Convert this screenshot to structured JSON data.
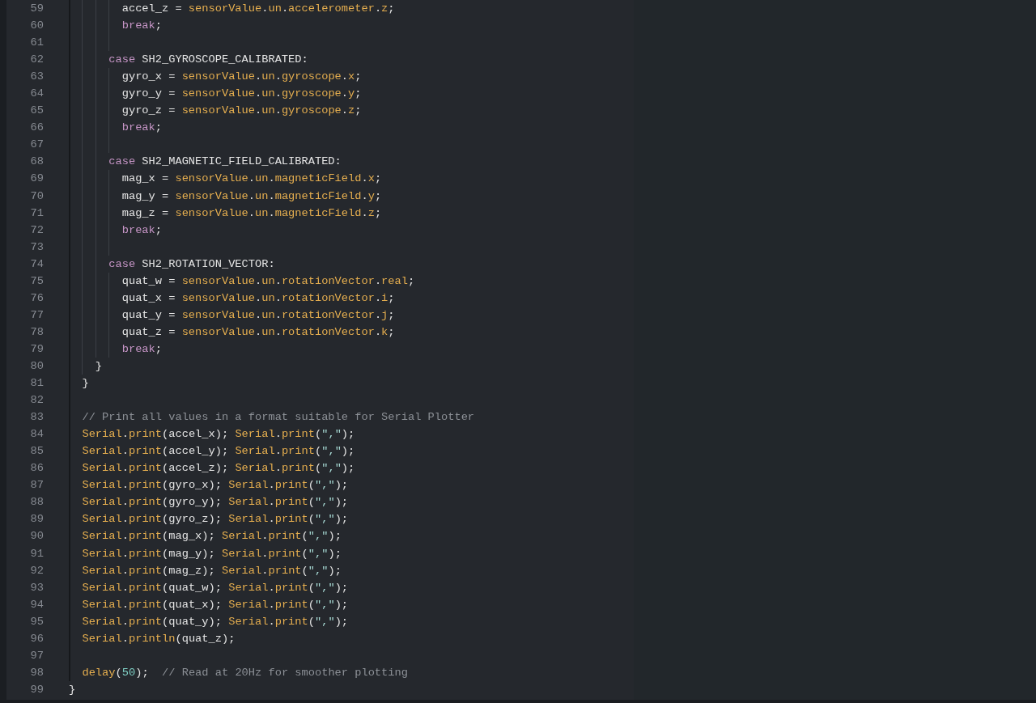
{
  "editor": {
    "lines": [
      {
        "number": "59",
        "tokens": [
          {
            "text": "        accel_z = ",
            "kind": "plain"
          },
          {
            "text": "sensorValue",
            "kind": "member"
          },
          {
            "text": ".",
            "kind": "plain"
          },
          {
            "text": "un",
            "kind": "member"
          },
          {
            "text": ".",
            "kind": "plain"
          },
          {
            "text": "accelerometer",
            "kind": "member"
          },
          {
            "text": ".",
            "kind": "plain"
          },
          {
            "text": "z",
            "kind": "member"
          },
          {
            "text": ";",
            "kind": "plain"
          }
        ]
      },
      {
        "number": "60",
        "tokens": [
          {
            "text": "        break",
            "kind": "keyword"
          },
          {
            "text": ";",
            "kind": "plain"
          }
        ]
      },
      {
        "number": "61"
      },
      {
        "number": "62",
        "tokens": [
          {
            "text": "      case",
            "kind": "keyword"
          },
          {
            "text": " SH2_GYROSCOPE_CALIBRATED:",
            "kind": "plain"
          }
        ]
      },
      {
        "number": "63",
        "tokens": [
          {
            "text": "        gyro_x = ",
            "kind": "plain"
          },
          {
            "text": "sensorValue",
            "kind": "member"
          },
          {
            "text": ".",
            "kind": "plain"
          },
          {
            "text": "un",
            "kind": "member"
          },
          {
            "text": ".",
            "kind": "plain"
          },
          {
            "text": "gyroscope",
            "kind": "member"
          },
          {
            "text": ".",
            "kind": "plain"
          },
          {
            "text": "x",
            "kind": "member"
          },
          {
            "text": ";",
            "kind": "plain"
          }
        ]
      },
      {
        "number": "64",
        "tokens": [
          {
            "text": "        gyro_y = ",
            "kind": "plain"
          },
          {
            "text": "sensorValue",
            "kind": "member"
          },
          {
            "text": ".",
            "kind": "plain"
          },
          {
            "text": "un",
            "kind": "member"
          },
          {
            "text": ".",
            "kind": "plain"
          },
          {
            "text": "gyroscope",
            "kind": "member"
          },
          {
            "text": ".",
            "kind": "plain"
          },
          {
            "text": "y",
            "kind": "member"
          },
          {
            "text": ";",
            "kind": "plain"
          }
        ]
      },
      {
        "number": "65",
        "tokens": [
          {
            "text": "        gyro_z = ",
            "kind": "plain"
          },
          {
            "text": "sensorValue",
            "kind": "member"
          },
          {
            "text": ".",
            "kind": "plain"
          },
          {
            "text": "un",
            "kind": "member"
          },
          {
            "text": ".",
            "kind": "plain"
          },
          {
            "text": "gyroscope",
            "kind": "member"
          },
          {
            "text": ".",
            "kind": "plain"
          },
          {
            "text": "z",
            "kind": "member"
          },
          {
            "text": ";",
            "kind": "plain"
          }
        ]
      },
      {
        "number": "66",
        "tokens": [
          {
            "text": "        break",
            "kind": "keyword"
          },
          {
            "text": ";",
            "kind": "plain"
          }
        ]
      },
      {
        "number": "67"
      },
      {
        "number": "68",
        "tokens": [
          {
            "text": "      case",
            "kind": "keyword"
          },
          {
            "text": " SH2_MAGNETIC_FIELD_CALIBRATED:",
            "kind": "plain"
          }
        ]
      },
      {
        "number": "69",
        "tokens": [
          {
            "text": "        mag_x = ",
            "kind": "plain"
          },
          {
            "text": "sensorValue",
            "kind": "member"
          },
          {
            "text": ".",
            "kind": "plain"
          },
          {
            "text": "un",
            "kind": "member"
          },
          {
            "text": ".",
            "kind": "plain"
          },
          {
            "text": "magneticField",
            "kind": "member"
          },
          {
            "text": ".",
            "kind": "plain"
          },
          {
            "text": "x",
            "kind": "member"
          },
          {
            "text": ";",
            "kind": "plain"
          }
        ]
      },
      {
        "number": "70",
        "tokens": [
          {
            "text": "        mag_y = ",
            "kind": "plain"
          },
          {
            "text": "sensorValue",
            "kind": "member"
          },
          {
            "text": ".",
            "kind": "plain"
          },
          {
            "text": "un",
            "kind": "member"
          },
          {
            "text": ".",
            "kind": "plain"
          },
          {
            "text": "magneticField",
            "kind": "member"
          },
          {
            "text": ".",
            "kind": "plain"
          },
          {
            "text": "y",
            "kind": "member"
          },
          {
            "text": ";",
            "kind": "plain"
          }
        ]
      },
      {
        "number": "71",
        "tokens": [
          {
            "text": "        mag_z = ",
            "kind": "plain"
          },
          {
            "text": "sensorValue",
            "kind": "member"
          },
          {
            "text": ".",
            "kind": "plain"
          },
          {
            "text": "un",
            "kind": "member"
          },
          {
            "text": ".",
            "kind": "plain"
          },
          {
            "text": "magneticField",
            "kind": "member"
          },
          {
            "text": ".",
            "kind": "plain"
          },
          {
            "text": "z",
            "kind": "member"
          },
          {
            "text": ";",
            "kind": "plain"
          }
        ]
      },
      {
        "number": "72",
        "tokens": [
          {
            "text": "        break",
            "kind": "keyword"
          },
          {
            "text": ";",
            "kind": "plain"
          }
        ]
      },
      {
        "number": "73"
      },
      {
        "number": "74",
        "tokens": [
          {
            "text": "      case",
            "kind": "keyword"
          },
          {
            "text": " SH2_ROTATION_VECTOR:",
            "kind": "plain"
          }
        ]
      },
      {
        "number": "75",
        "tokens": [
          {
            "text": "        quat_w = ",
            "kind": "plain"
          },
          {
            "text": "sensorValue",
            "kind": "member"
          },
          {
            "text": ".",
            "kind": "plain"
          },
          {
            "text": "un",
            "kind": "member"
          },
          {
            "text": ".",
            "kind": "plain"
          },
          {
            "text": "rotationVector",
            "kind": "member"
          },
          {
            "text": ".",
            "kind": "plain"
          },
          {
            "text": "real",
            "kind": "member"
          },
          {
            "text": ";",
            "kind": "plain"
          }
        ]
      },
      {
        "number": "76",
        "tokens": [
          {
            "text": "        quat_x = ",
            "kind": "plain"
          },
          {
            "text": "sensorValue",
            "kind": "member"
          },
          {
            "text": ".",
            "kind": "plain"
          },
          {
            "text": "un",
            "kind": "member"
          },
          {
            "text": ".",
            "kind": "plain"
          },
          {
            "text": "rotationVector",
            "kind": "member"
          },
          {
            "text": ".",
            "kind": "plain"
          },
          {
            "text": "i",
            "kind": "member"
          },
          {
            "text": ";",
            "kind": "plain"
          }
        ]
      },
      {
        "number": "77",
        "tokens": [
          {
            "text": "        quat_y = ",
            "kind": "plain"
          },
          {
            "text": "sensorValue",
            "kind": "member"
          },
          {
            "text": ".",
            "kind": "plain"
          },
          {
            "text": "un",
            "kind": "member"
          },
          {
            "text": ".",
            "kind": "plain"
          },
          {
            "text": "rotationVector",
            "kind": "member"
          },
          {
            "text": ".",
            "kind": "plain"
          },
          {
            "text": "j",
            "kind": "member"
          },
          {
            "text": ";",
            "kind": "plain"
          }
        ]
      },
      {
        "number": "78",
        "tokens": [
          {
            "text": "        quat_z = ",
            "kind": "plain"
          },
          {
            "text": "sensorValue",
            "kind": "member"
          },
          {
            "text": ".",
            "kind": "plain"
          },
          {
            "text": "un",
            "kind": "member"
          },
          {
            "text": ".",
            "kind": "plain"
          },
          {
            "text": "rotationVector",
            "kind": "member"
          },
          {
            "text": ".",
            "kind": "plain"
          },
          {
            "text": "k",
            "kind": "member"
          },
          {
            "text": ";",
            "kind": "plain"
          }
        ]
      },
      {
        "number": "79",
        "tokens": [
          {
            "text": "        break",
            "kind": "keyword"
          },
          {
            "text": ";",
            "kind": "plain"
          }
        ]
      },
      {
        "number": "80",
        "tokens": [
          {
            "text": "    }",
            "kind": "plain"
          }
        ]
      },
      {
        "number": "81",
        "tokens": [
          {
            "text": "  }",
            "kind": "plain"
          }
        ]
      },
      {
        "number": "82"
      },
      {
        "number": "83",
        "tokens": [
          {
            "text": "  // Print all values in a format suitable for Serial Plotter",
            "kind": "comment"
          }
        ]
      },
      {
        "number": "84",
        "tokens": [
          {
            "text": "  Serial",
            "kind": "member"
          },
          {
            "text": ".",
            "kind": "plain"
          },
          {
            "text": "print",
            "kind": "member"
          },
          {
            "text": "(accel_x); ",
            "kind": "plain"
          },
          {
            "text": "Serial",
            "kind": "member"
          },
          {
            "text": ".",
            "kind": "plain"
          },
          {
            "text": "print",
            "kind": "member"
          },
          {
            "text": "(",
            "kind": "plain"
          },
          {
            "text": "\",\"",
            "kind": "string"
          },
          {
            "text": ");",
            "kind": "plain"
          }
        ]
      },
      {
        "number": "85",
        "tokens": [
          {
            "text": "  Serial",
            "kind": "member"
          },
          {
            "text": ".",
            "kind": "plain"
          },
          {
            "text": "print",
            "kind": "member"
          },
          {
            "text": "(accel_y); ",
            "kind": "plain"
          },
          {
            "text": "Serial",
            "kind": "member"
          },
          {
            "text": ".",
            "kind": "plain"
          },
          {
            "text": "print",
            "kind": "member"
          },
          {
            "text": "(",
            "kind": "plain"
          },
          {
            "text": "\",\"",
            "kind": "string"
          },
          {
            "text": ");",
            "kind": "plain"
          }
        ]
      },
      {
        "number": "86",
        "tokens": [
          {
            "text": "  Serial",
            "kind": "member"
          },
          {
            "text": ".",
            "kind": "plain"
          },
          {
            "text": "print",
            "kind": "member"
          },
          {
            "text": "(accel_z); ",
            "kind": "plain"
          },
          {
            "text": "Serial",
            "kind": "member"
          },
          {
            "text": ".",
            "kind": "plain"
          },
          {
            "text": "print",
            "kind": "member"
          },
          {
            "text": "(",
            "kind": "plain"
          },
          {
            "text": "\",\"",
            "kind": "string"
          },
          {
            "text": ");",
            "kind": "plain"
          }
        ]
      },
      {
        "number": "87",
        "tokens": [
          {
            "text": "  Serial",
            "kind": "member"
          },
          {
            "text": ".",
            "kind": "plain"
          },
          {
            "text": "print",
            "kind": "member"
          },
          {
            "text": "(gyro_x); ",
            "kind": "plain"
          },
          {
            "text": "Serial",
            "kind": "member"
          },
          {
            "text": ".",
            "kind": "plain"
          },
          {
            "text": "print",
            "kind": "member"
          },
          {
            "text": "(",
            "kind": "plain"
          },
          {
            "text": "\",\"",
            "kind": "string"
          },
          {
            "text": ");",
            "kind": "plain"
          }
        ]
      },
      {
        "number": "88",
        "tokens": [
          {
            "text": "  Serial",
            "kind": "member"
          },
          {
            "text": ".",
            "kind": "plain"
          },
          {
            "text": "print",
            "kind": "member"
          },
          {
            "text": "(gyro_y); ",
            "kind": "plain"
          },
          {
            "text": "Serial",
            "kind": "member"
          },
          {
            "text": ".",
            "kind": "plain"
          },
          {
            "text": "print",
            "kind": "member"
          },
          {
            "text": "(",
            "kind": "plain"
          },
          {
            "text": "\",\"",
            "kind": "string"
          },
          {
            "text": ");",
            "kind": "plain"
          }
        ]
      },
      {
        "number": "89",
        "tokens": [
          {
            "text": "  Serial",
            "kind": "member"
          },
          {
            "text": ".",
            "kind": "plain"
          },
          {
            "text": "print",
            "kind": "member"
          },
          {
            "text": "(gyro_z); ",
            "kind": "plain"
          },
          {
            "text": "Serial",
            "kind": "member"
          },
          {
            "text": ".",
            "kind": "plain"
          },
          {
            "text": "print",
            "kind": "member"
          },
          {
            "text": "(",
            "kind": "plain"
          },
          {
            "text": "\",\"",
            "kind": "string"
          },
          {
            "text": ");",
            "kind": "plain"
          }
        ]
      },
      {
        "number": "90",
        "tokens": [
          {
            "text": "  Serial",
            "kind": "member"
          },
          {
            "text": ".",
            "kind": "plain"
          },
          {
            "text": "print",
            "kind": "member"
          },
          {
            "text": "(mag_x); ",
            "kind": "plain"
          },
          {
            "text": "Serial",
            "kind": "member"
          },
          {
            "text": ".",
            "kind": "plain"
          },
          {
            "text": "print",
            "kind": "member"
          },
          {
            "text": "(",
            "kind": "plain"
          },
          {
            "text": "\",\"",
            "kind": "string"
          },
          {
            "text": ");",
            "kind": "plain"
          }
        ]
      },
      {
        "number": "91",
        "tokens": [
          {
            "text": "  Serial",
            "kind": "member"
          },
          {
            "text": ".",
            "kind": "plain"
          },
          {
            "text": "print",
            "kind": "member"
          },
          {
            "text": "(mag_y); ",
            "kind": "plain"
          },
          {
            "text": "Serial",
            "kind": "member"
          },
          {
            "text": ".",
            "kind": "plain"
          },
          {
            "text": "print",
            "kind": "member"
          },
          {
            "text": "(",
            "kind": "plain"
          },
          {
            "text": "\",\"",
            "kind": "string"
          },
          {
            "text": ");",
            "kind": "plain"
          }
        ]
      },
      {
        "number": "92",
        "tokens": [
          {
            "text": "  Serial",
            "kind": "member"
          },
          {
            "text": ".",
            "kind": "plain"
          },
          {
            "text": "print",
            "kind": "member"
          },
          {
            "text": "(mag_z); ",
            "kind": "plain"
          },
          {
            "text": "Serial",
            "kind": "member"
          },
          {
            "text": ".",
            "kind": "plain"
          },
          {
            "text": "print",
            "kind": "member"
          },
          {
            "text": "(",
            "kind": "plain"
          },
          {
            "text": "\",\"",
            "kind": "string"
          },
          {
            "text": ");",
            "kind": "plain"
          }
        ]
      },
      {
        "number": "93",
        "tokens": [
          {
            "text": "  Serial",
            "kind": "member"
          },
          {
            "text": ".",
            "kind": "plain"
          },
          {
            "text": "print",
            "kind": "member"
          },
          {
            "text": "(quat_w); ",
            "kind": "plain"
          },
          {
            "text": "Serial",
            "kind": "member"
          },
          {
            "text": ".",
            "kind": "plain"
          },
          {
            "text": "print",
            "kind": "member"
          },
          {
            "text": "(",
            "kind": "plain"
          },
          {
            "text": "\",\"",
            "kind": "string"
          },
          {
            "text": ");",
            "kind": "plain"
          }
        ]
      },
      {
        "number": "94",
        "tokens": [
          {
            "text": "  Serial",
            "kind": "member"
          },
          {
            "text": ".",
            "kind": "plain"
          },
          {
            "text": "print",
            "kind": "member"
          },
          {
            "text": "(quat_x); ",
            "kind": "plain"
          },
          {
            "text": "Serial",
            "kind": "member"
          },
          {
            "text": ".",
            "kind": "plain"
          },
          {
            "text": "print",
            "kind": "member"
          },
          {
            "text": "(",
            "kind": "plain"
          },
          {
            "text": "\",\"",
            "kind": "string"
          },
          {
            "text": ");",
            "kind": "plain"
          }
        ]
      },
      {
        "number": "95",
        "tokens": [
          {
            "text": "  Serial",
            "kind": "member"
          },
          {
            "text": ".",
            "kind": "plain"
          },
          {
            "text": "print",
            "kind": "member"
          },
          {
            "text": "(quat_y); ",
            "kind": "plain"
          },
          {
            "text": "Serial",
            "kind": "member"
          },
          {
            "text": ".",
            "kind": "plain"
          },
          {
            "text": "print",
            "kind": "member"
          },
          {
            "text": "(",
            "kind": "plain"
          },
          {
            "text": "\",\"",
            "kind": "string"
          },
          {
            "text": ");",
            "kind": "plain"
          }
        ]
      },
      {
        "number": "96",
        "tokens": [
          {
            "text": "  Serial",
            "kind": "member"
          },
          {
            "text": ".",
            "kind": "plain"
          },
          {
            "text": "println",
            "kind": "member"
          },
          {
            "text": "(quat_z);",
            "kind": "plain"
          }
        ]
      },
      {
        "number": "97"
      },
      {
        "number": "98",
        "tokens": [
          {
            "text": "  delay",
            "kind": "member"
          },
          {
            "text": "(",
            "kind": "plain"
          },
          {
            "text": "50",
            "kind": "number"
          },
          {
            "text": ");  ",
            "kind": "plain"
          },
          {
            "text": "// Read at 20Hz for smoother plotting",
            "kind": "comment"
          }
        ]
      },
      {
        "number": "99",
        "tokens": [
          {
            "text": "}",
            "kind": "plain"
          }
        ]
      }
    ]
  }
}
